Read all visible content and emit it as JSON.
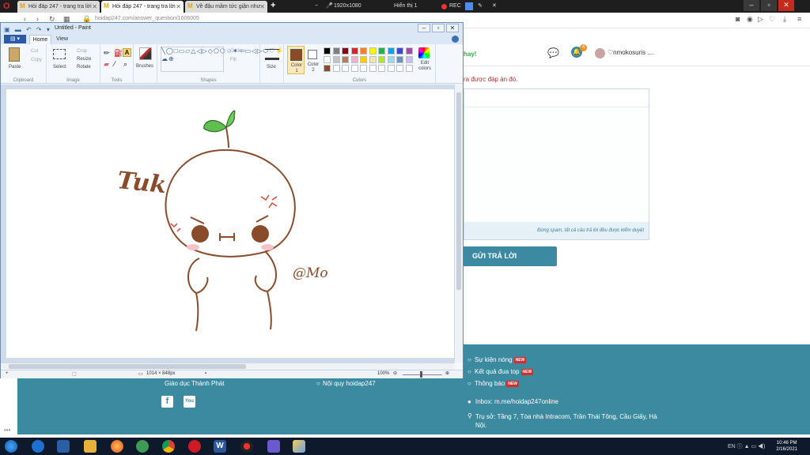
{
  "browser": {
    "tabs": [
      {
        "label": "Hỏi đáp 247 - trang tra lời",
        "active": false
      },
      {
        "label": "Hỏi đáp 247 - trang tra lời",
        "active": true
      },
      {
        "label": "Về đậu mầm tức giận như",
        "active": false
      }
    ],
    "new_tab": "+",
    "recorder": {
      "resolution": "1920x1080",
      "display": "Hiển thị 1",
      "rec": "REC"
    },
    "url": "hoidap247.com/answer_question/1606005"
  },
  "paint": {
    "title": "Untitled - Paint",
    "tabs": {
      "file": "",
      "home": "Home",
      "view": "View"
    },
    "clipboard": {
      "paste": "Paste",
      "cut": "Cut",
      "copy": "Copy",
      "label": "Clipboard"
    },
    "image": {
      "select": "Select",
      "crop": "Crop",
      "resize": "Resize",
      "rotate": "Rotate",
      "label": "Image"
    },
    "tools": {
      "label": "Tools"
    },
    "brushes": {
      "label": "Brushes"
    },
    "shapes": {
      "outline": "Outline",
      "fill": "Fill",
      "label": "Shapes"
    },
    "size": {
      "label": "Size"
    },
    "colors": {
      "color1": "Color 1",
      "color2": "Color 2",
      "edit": "Edit colors",
      "label": "Colors",
      "palette": [
        "#000000",
        "#7f7f7f",
        "#880015",
        "#ed1c24",
        "#ff7f27",
        "#fff200",
        "#22b14c",
        "#00a2e8",
        "#3f48cc",
        "#a349a4",
        "#ffffff",
        "#c3c3c3",
        "#b97a57",
        "#ffaec9",
        "#ffc90e",
        "#efe4b0",
        "#b5e61d",
        "#99d9ea",
        "#7092be",
        "#c8bfe7",
        "#8a4b2b",
        "#ffffff",
        "#ffffff",
        "#ffffff",
        "#ffffff",
        "#ffffff",
        "#ffffff",
        "#ffffff",
        "#ffffff",
        "#ffffff"
      ],
      "color1_value": "#8a4b2b"
    },
    "drawing": {
      "tuk": "Tuk",
      "signature": "@Mo"
    },
    "status": {
      "dimensions": "1014 × 848px",
      "zoom": "100%"
    }
  },
  "site": {
    "hay": "hay!",
    "notif_count": "4",
    "username": "♡nmokosuris ....",
    "notice": "ra được đáp án đó.",
    "answer_footer": "Đừng spam, tất cả câu trả lời đều được kiểm duyệt",
    "submit": "GỬI TRẢ LỜI",
    "footer": {
      "company": "Giáo dục Thành Phát",
      "rules": "Nội quy hoidap247",
      "events": "Sự kiện nóng",
      "results": "Kết quả đua top",
      "news": "Thông báo",
      "new_badge": "NEW",
      "inbox": "Inbox: m.me/hoidap247online",
      "address": "Trụ sở: Tầng 7, Tòa nhà Intracom, Trần Thái Tông, Cầu Giấy, Hà Nội."
    }
  },
  "taskbar": {
    "time": "10:46 PM",
    "date": "2/16/2021"
  }
}
